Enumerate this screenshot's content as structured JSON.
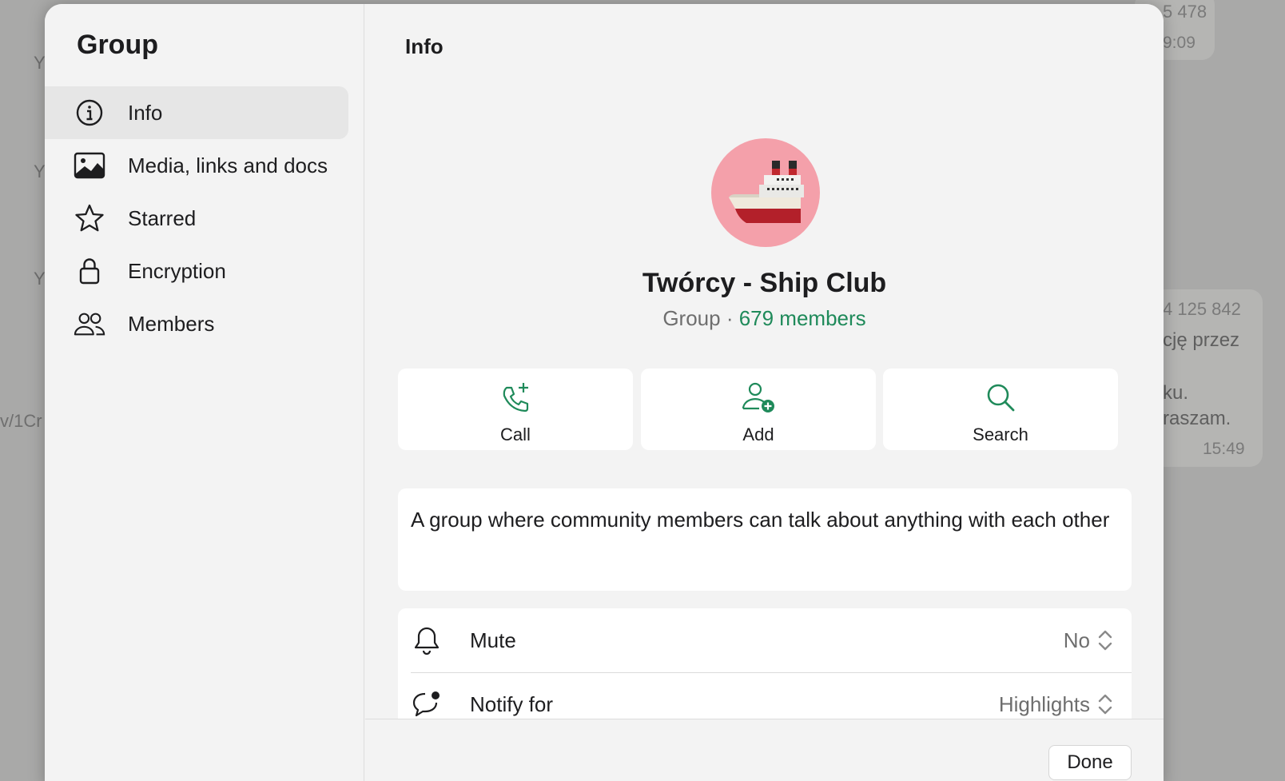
{
  "background": {
    "left_fragments": [
      "Y",
      "Y",
      "Y",
      "v/1Cr"
    ],
    "bubble_top": {
      "line1": "5 478",
      "time": "9:09"
    },
    "bubble_mid": {
      "line1": "4 125 842",
      "line2": "cję przez",
      "line3": "ku.",
      "line4": "raszam.",
      "time": "15:49"
    }
  },
  "sidebar": {
    "title": "Group",
    "items": [
      {
        "label": "Info",
        "icon": "info-icon",
        "active": true
      },
      {
        "label": "Media, links and docs",
        "icon": "image-icon",
        "active": false
      },
      {
        "label": "Starred",
        "icon": "star-icon",
        "active": false
      },
      {
        "label": "Encryption",
        "icon": "lock-icon",
        "active": false
      },
      {
        "label": "Members",
        "icon": "members-icon",
        "active": false
      }
    ]
  },
  "main": {
    "title": "Info",
    "group_name": "Twórcy - Ship Club",
    "group_type": "Group · ",
    "members_count": "679 members",
    "actions": [
      {
        "label": "Call",
        "icon": "call-add-icon"
      },
      {
        "label": "Add",
        "icon": "add-person-icon"
      },
      {
        "label": "Search",
        "icon": "search-icon"
      }
    ],
    "description": "A group where community members can talk about anything with each other",
    "settings": [
      {
        "label": "Mute",
        "value": "No",
        "icon": "bell-icon"
      },
      {
        "label": "Notify for",
        "value": "Highlights",
        "icon": "chat-bubble-icon"
      }
    ],
    "done_label": "Done"
  },
  "colors": {
    "accent": "#1f8a5a",
    "avatar_bg": "#f4a0aa",
    "panel": "#f3f3f3"
  }
}
